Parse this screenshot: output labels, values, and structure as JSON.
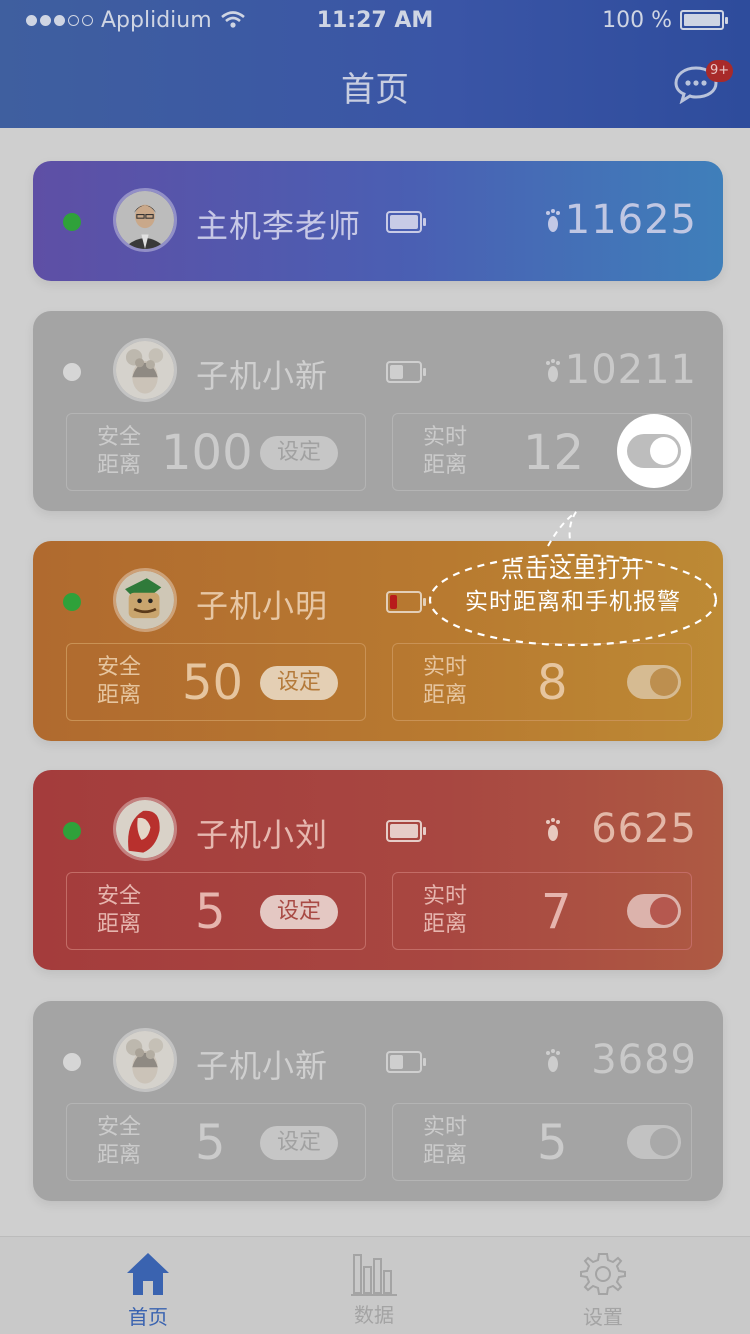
{
  "status_bar": {
    "carrier": "Applidium",
    "time": "11:27 AM",
    "battery": "100 %"
  },
  "header": {
    "title": "首页",
    "badge": "9+"
  },
  "cards": [
    {
      "name": "主机李老师",
      "steps": "11625"
    },
    {
      "name": "子机小新",
      "steps": "10211",
      "safe_label": "安全\n距离",
      "safe_value": "100",
      "set_label": "设定",
      "live_label": "实时\n距离",
      "live_value": "12"
    },
    {
      "name": "子机小明",
      "steps": "",
      "safe_label": "安全\n距离",
      "safe_value": "50",
      "set_label": "设定",
      "live_label": "实时\n距离",
      "live_value": "8"
    },
    {
      "name": "子机小刘",
      "steps": "6625",
      "safe_label": "安全\n距离",
      "safe_value": "5",
      "set_label": "设定",
      "live_label": "实时\n距离",
      "live_value": "7"
    },
    {
      "name": "子机小新",
      "steps": "3689",
      "safe_label": "安全\n距离",
      "safe_value": "5",
      "set_label": "设定",
      "live_label": "实时\n距离",
      "live_value": "5"
    }
  ],
  "tooltip": {
    "line1": "点击这里打开",
    "line2": "实时距离和手机报警"
  },
  "tabs": [
    {
      "label": "首页"
    },
    {
      "label": "数据"
    },
    {
      "label": "设置"
    }
  ],
  "colors": {
    "header": "#3a55a6",
    "active_tab": "#3a63b0",
    "online": "#2fa13a",
    "low_battery": "#b81b1b"
  }
}
